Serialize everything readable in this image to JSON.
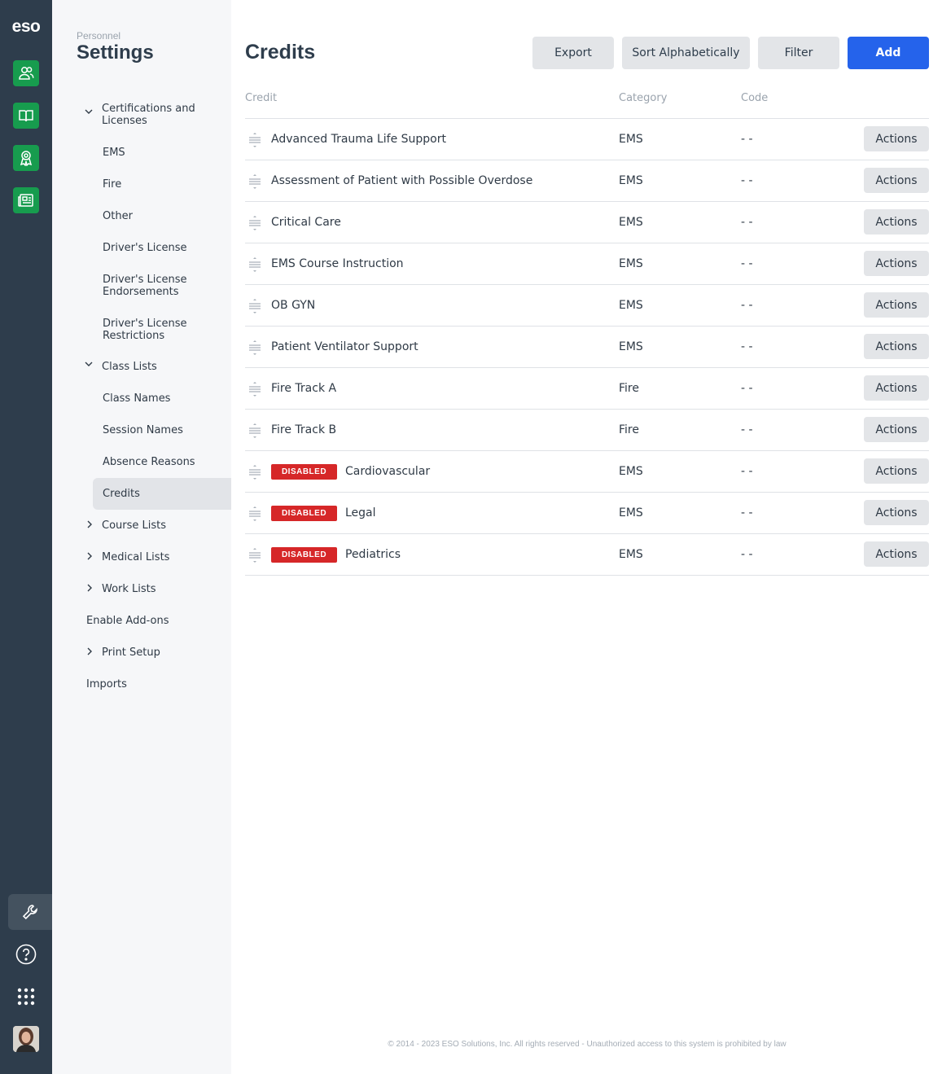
{
  "rail": {
    "logo": "eso",
    "apps": [
      "people-icon",
      "book-icon",
      "award-icon",
      "news-icon"
    ],
    "bottom": [
      "wrench-icon",
      "help-icon",
      "grid-icon",
      "avatar"
    ],
    "accent": "#179c4e",
    "background": "#2e3d4c"
  },
  "sidebar": {
    "crumb": "Personnel",
    "title": "Settings",
    "items": [
      {
        "label": "Certifications and Licenses",
        "expanded": true
      },
      {
        "label": "EMS"
      },
      {
        "label": "Fire"
      },
      {
        "label": "Other"
      },
      {
        "label": "Driver's License"
      },
      {
        "label": "Driver's License Endorsements"
      },
      {
        "label": "Driver's License Restrictions"
      },
      {
        "label": "Class Lists",
        "expanded": true
      },
      {
        "label": "Class Names"
      },
      {
        "label": "Session Names"
      },
      {
        "label": "Absence Reasons"
      },
      {
        "label": "Credits",
        "active": true
      },
      {
        "label": "Course Lists",
        "expanded": false
      },
      {
        "label": "Medical Lists",
        "expanded": false
      },
      {
        "label": "Work Lists",
        "expanded": false
      },
      {
        "label": "Enable Add-ons"
      },
      {
        "label": "Print Setup",
        "expanded": false
      },
      {
        "label": "Imports"
      }
    ]
  },
  "main": {
    "title": "Credits",
    "buttons": {
      "export": "Export",
      "sort": "Sort Alphabetically",
      "filter": "Filter",
      "add": "Add"
    },
    "columns": {
      "credit": "Credit",
      "category": "Category",
      "code": "Code"
    },
    "rows": [
      {
        "name": "Advanced Trauma Life Support",
        "category": "EMS",
        "code": "- -",
        "disabled": false,
        "action": "Actions"
      },
      {
        "name": "Assessment of Patient with Possible Overdose",
        "category": "EMS",
        "code": "- -",
        "disabled": false,
        "action": "Actions"
      },
      {
        "name": "Critical Care",
        "category": "EMS",
        "code": "- -",
        "disabled": false,
        "action": "Actions"
      },
      {
        "name": "EMS Course Instruction",
        "category": "EMS",
        "code": "- -",
        "disabled": false,
        "action": "Actions"
      },
      {
        "name": "OB GYN",
        "category": "EMS",
        "code": "- -",
        "disabled": false,
        "action": "Actions"
      },
      {
        "name": "Patient Ventilator Support",
        "category": "EMS",
        "code": "- -",
        "disabled": false,
        "action": "Actions"
      },
      {
        "name": "Fire Track A",
        "category": "Fire",
        "code": "- -",
        "disabled": false,
        "action": "Actions"
      },
      {
        "name": "Fire Track B",
        "category": "Fire",
        "code": "- -",
        "disabled": false,
        "action": "Actions"
      },
      {
        "name": "Cardiovascular",
        "category": "EMS",
        "code": "- -",
        "disabled": true,
        "badge": "DISABLED",
        "action": "Actions"
      },
      {
        "name": "Legal",
        "category": "EMS",
        "code": "- -",
        "disabled": true,
        "badge": "DISABLED",
        "action": "Actions"
      },
      {
        "name": "Pediatrics",
        "category": "EMS",
        "code": "- -",
        "disabled": true,
        "badge": "DISABLED",
        "action": "Actions"
      }
    ],
    "badge_color": "#d62728",
    "primary_color": "#2563eb"
  },
  "footer": "© 2014 - 2023 ESO Solutions, Inc. All rights reserved - Unauthorized access to this system is prohibited by law"
}
